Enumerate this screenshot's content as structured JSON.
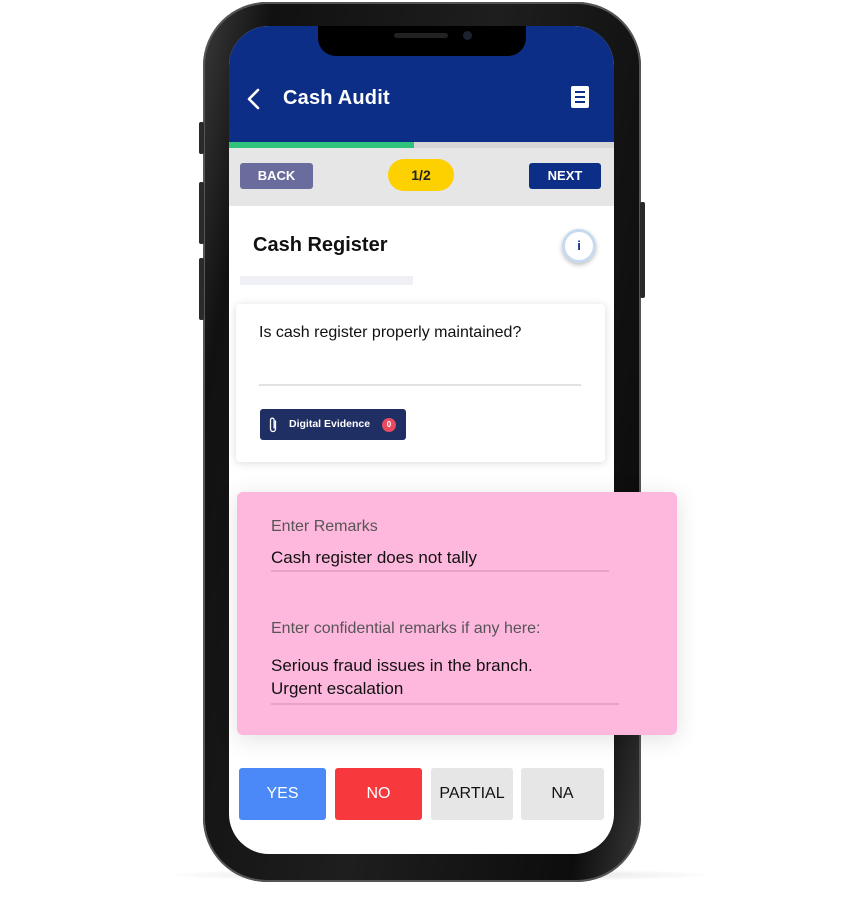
{
  "header": {
    "title": "Cash Audit",
    "back_icon": "chevron-left-icon",
    "doc_icon": "document-icon"
  },
  "progress": {
    "fraction": 0.48,
    "color": "#2fc37b"
  },
  "nav": {
    "back_label": "BACK",
    "step": "1/2",
    "next_label": "NEXT"
  },
  "section": {
    "title": "Cash Register",
    "info_icon": "i"
  },
  "question": {
    "text": "Is cash register properly maintained?",
    "evidence_label": "Digital Evidence",
    "evidence_count": "0"
  },
  "remarks": {
    "label": "Enter Remarks",
    "value": "Cash register does not tally",
    "confidential_label": "Enter confidential remarks if any here:",
    "confidential_line1": "Serious fraud issues in the branch.",
    "confidential_line2": "Urgent escalation"
  },
  "answers": [
    {
      "label": "YES",
      "color": "#4a89f7"
    },
    {
      "label": "NO",
      "color": "#f7393e"
    },
    {
      "label": "PARTIAL",
      "color": "#e6e6e6"
    },
    {
      "label": "NA",
      "color": "#e6e6e6"
    }
  ],
  "colors": {
    "brand": "#0c2e87",
    "accent": "#fdd000",
    "remarks_bg": "#ffb8dd"
  }
}
